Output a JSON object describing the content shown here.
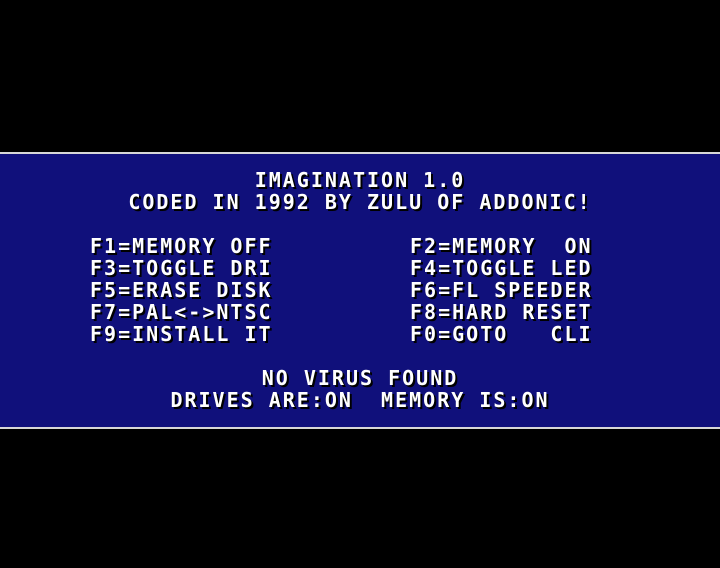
{
  "header": {
    "title": "IMAGINATION 1.0",
    "credits": "CODED IN 1992 BY ZULU OF ADDONIC!"
  },
  "menu": {
    "rows": [
      {
        "left": "F1=MEMORY OFF",
        "right": "F2=MEMORY  ON"
      },
      {
        "left": "F3=TOGGLE DRI",
        "right": "F4=TOGGLE LED"
      },
      {
        "left": "F5=ERASE DISK",
        "right": "F6=FL SPEEDER"
      },
      {
        "left": "F7=PAL<->NTSC",
        "right": "F8=HARD RESET"
      },
      {
        "left": "F9=INSTALL IT",
        "right": "F0=GOTO   CLI"
      }
    ]
  },
  "status": {
    "virus": "NO VIRUS FOUND",
    "state": "DRIVES ARE:ON  MEMORY IS:ON"
  },
  "colors": {
    "background": "#000000",
    "panel": "#10107b",
    "text": "#ffffff",
    "border": "#d8d8d8"
  }
}
